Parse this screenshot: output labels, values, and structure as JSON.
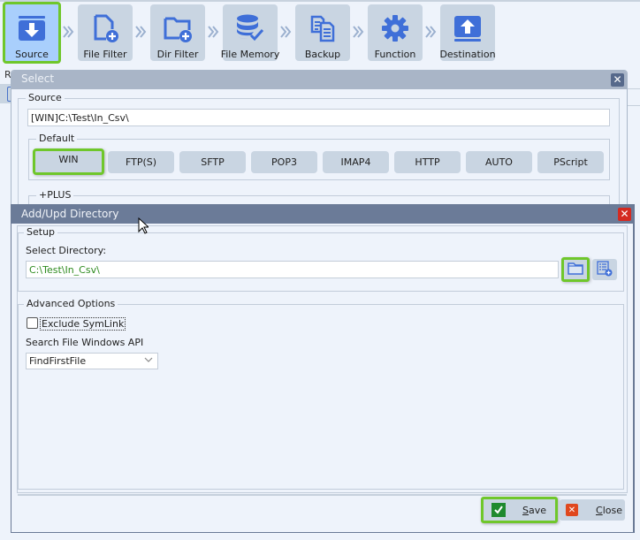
{
  "toolbar": {
    "steps": [
      {
        "label": "Source",
        "icon": "download-box-icon",
        "active": true
      },
      {
        "label": "File Filter",
        "icon": "file-add-icon",
        "active": false
      },
      {
        "label": "Dir Filter",
        "icon": "folder-add-icon",
        "active": false
      },
      {
        "label": "File Memory",
        "icon": "database-check-icon",
        "active": false
      },
      {
        "label": "Backup",
        "icon": "copy-documents-icon",
        "active": false
      },
      {
        "label": "Function",
        "icon": "gear-icon",
        "active": false
      },
      {
        "label": "Destination",
        "icon": "upload-box-icon",
        "active": false
      }
    ]
  },
  "background": {
    "partial_label": "R"
  },
  "select_dialog": {
    "title": "Select",
    "source_group_label": "Source",
    "source_value": "[WIN]C:\\Test\\In_Csv\\",
    "default_group_label": "Default",
    "protocols": [
      "WIN",
      "FTP(S)",
      "SFTP",
      "POP3",
      "IMAP4",
      "HTTP",
      "AUTO",
      "PScript"
    ],
    "selected_protocol": "WIN",
    "plus_group_label": "+PLUS"
  },
  "add_dialog": {
    "title": "Add/Upd Directory",
    "setup_group_label": "Setup",
    "select_directory_label": "Select Directory:",
    "directory_value": "C:\\Test\\In_Csv\\",
    "advanced_group_label": "Advanced  Options",
    "exclude_symlink_label": "Exclude SymLink",
    "exclude_symlink_checked": false,
    "search_api_label": "Search File Windows API",
    "search_api_value": "FindFirstFile",
    "save_label_prefix": "",
    "save_mnemonic": "S",
    "save_label_rest": "ave",
    "close_mnemonic": "C",
    "close_label_rest": "lose"
  },
  "colors": {
    "highlight": "#6fc72b",
    "icon_blue": "#3f6fd8",
    "active_step": "#a9cffc",
    "close_red": "#d42a21",
    "save_green": "#1f8a2e",
    "close_orange": "#e0481e",
    "path_green": "#2e8b1f"
  }
}
